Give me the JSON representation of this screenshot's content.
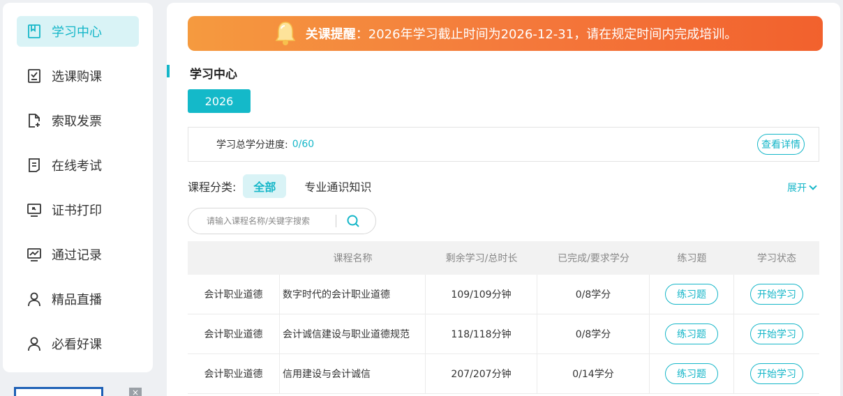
{
  "sidebar": {
    "items": [
      {
        "label": "学习中心",
        "icon": "bookmark-book-icon",
        "active": true
      },
      {
        "label": "选课购课",
        "icon": "checklist-icon"
      },
      {
        "label": "索取发票",
        "icon": "invoice-add-icon"
      },
      {
        "label": "在线考试",
        "icon": "exam-doc-icon"
      },
      {
        "label": "证书打印",
        "icon": "certificate-icon"
      },
      {
        "label": "通过记录",
        "icon": "chart-record-icon"
      },
      {
        "label": "精品直播",
        "icon": "user-icon"
      },
      {
        "label": "必看好课",
        "icon": "user-icon"
      }
    ]
  },
  "banner": {
    "title": "关课提醒",
    "message": "：2026年学习截止时间为2026-12-31，请在规定时间内完成培训。"
  },
  "main": {
    "section_title": "学习中心",
    "year": "2026",
    "progress": {
      "label": "学习总学分进度:",
      "value": "0/60",
      "detail_button": "查看详情"
    },
    "category": {
      "label": "课程分类:",
      "all": "全部",
      "items": [
        "专业通识知识"
      ],
      "expand": "展开"
    },
    "search": {
      "placeholder": "请输入课程名称/关键字搜索"
    }
  },
  "table": {
    "headers": [
      "",
      "课程名称",
      "剩余学习/总时长",
      "已完成/要求学分",
      "练习题",
      "学习状态"
    ],
    "rows": [
      {
        "category": "会计职业道德",
        "name": "数字时代的会计职业道德",
        "duration": "109/109分钟",
        "credits": "0/8学分",
        "practice": "练习题",
        "status": "开始学习"
      },
      {
        "category": "会计职业道德",
        "name": "会计诚信建设与职业道德规范",
        "duration": "118/118分钟",
        "credits": "0/8学分",
        "practice": "练习题",
        "status": "开始学习"
      },
      {
        "category": "会计职业道德",
        "name": "信用建设与会计诚信",
        "duration": "207/207分钟",
        "credits": "0/14学分",
        "practice": "练习题",
        "status": "开始学习"
      }
    ]
  },
  "colors": {
    "accent": "#14b6c8",
    "banner_start": "#f59a3f",
    "banner_end": "#f2612d"
  }
}
